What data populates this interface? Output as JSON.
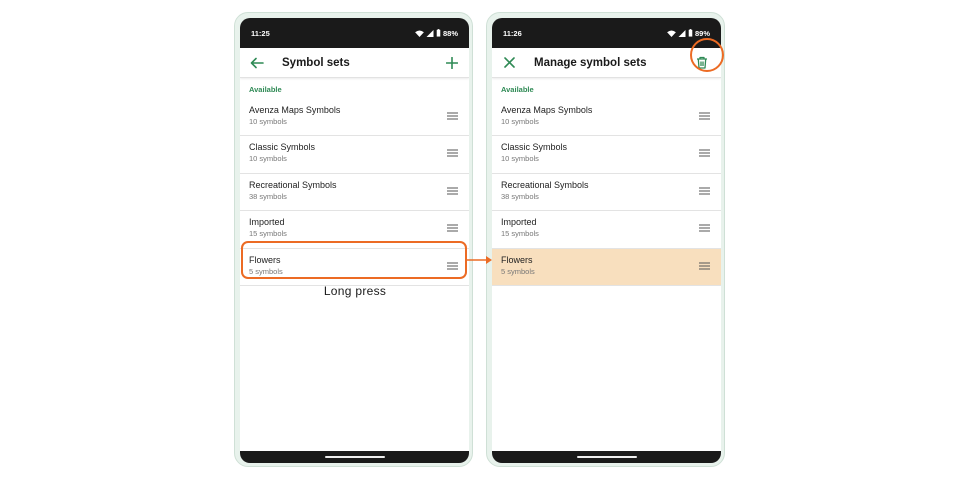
{
  "colors": {
    "accent_green": "#2f8a55",
    "highlight_orange": "#ec6b24",
    "selected_row": "#f8dfbe"
  },
  "left_phone": {
    "status_time": "11:25",
    "battery": "88%",
    "title": "Symbol sets",
    "section": "Available",
    "back_icon": "arrow-left-icon",
    "add_icon": "plus-icon",
    "items": [
      {
        "name": "Avenza Maps Symbols",
        "count": "10 symbols"
      },
      {
        "name": "Classic Symbols",
        "count": "10 symbols"
      },
      {
        "name": "Recreational Symbols",
        "count": "38 symbols"
      },
      {
        "name": "Imported",
        "count": "15 symbols"
      },
      {
        "name": "Flowers",
        "count": "5 symbols"
      }
    ]
  },
  "right_phone": {
    "status_time": "11:26",
    "battery": "89%",
    "title": "Manage symbol sets",
    "section": "Available",
    "close_icon": "close-icon",
    "delete_icon": "trash-icon",
    "items": [
      {
        "name": "Avenza Maps Symbols",
        "count": "10 symbols"
      },
      {
        "name": "Classic Symbols",
        "count": "10 symbols"
      },
      {
        "name": "Recreational Symbols",
        "count": "38 symbols"
      },
      {
        "name": "Imported",
        "count": "15 symbols"
      },
      {
        "name": "Flowers",
        "count": "5 symbols",
        "selected": true
      }
    ]
  },
  "annotation": {
    "caption": "Long press"
  }
}
